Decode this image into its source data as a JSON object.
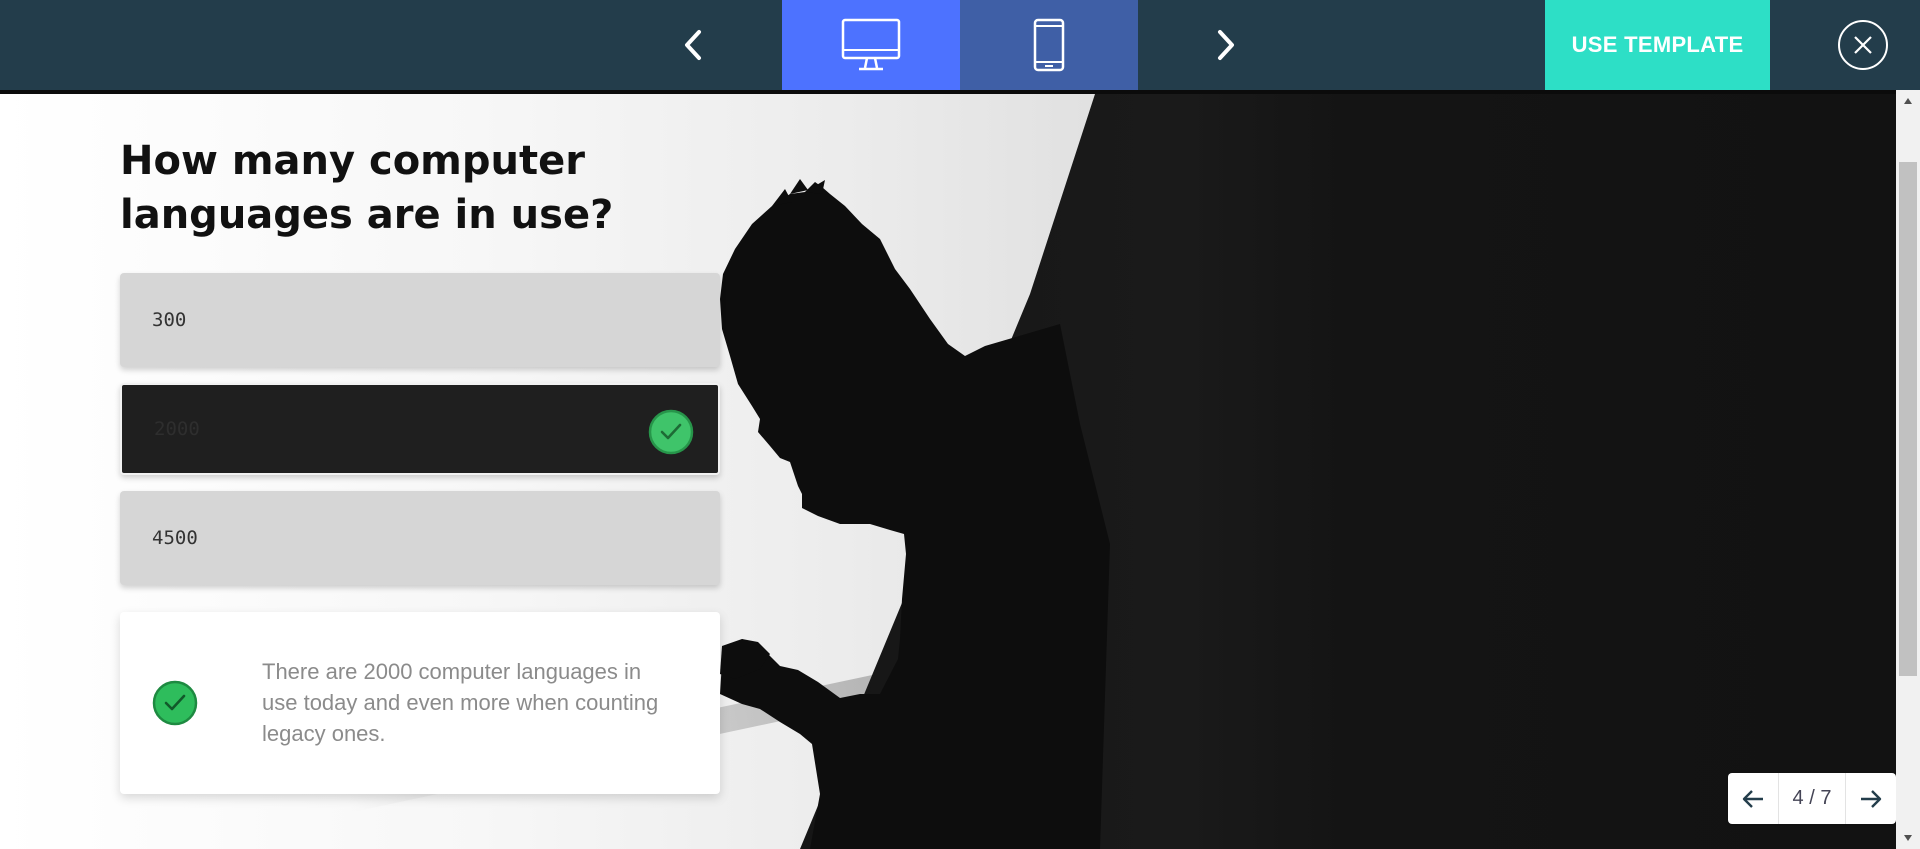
{
  "toolbar": {
    "prev_label": "previous",
    "next_label": "next",
    "use_template_label": "USE TEMPLATE",
    "colors": {
      "bar": "#233d4b",
      "desktop_active": "#4d72ff",
      "mobile": "#3f5fa6",
      "accent": "#2ddfc6"
    }
  },
  "quiz": {
    "question": "How many computer languages are in use?",
    "answers": [
      {
        "label": "300",
        "selected": false
      },
      {
        "label": "2000",
        "selected": true
      },
      {
        "label": "4500",
        "selected": false
      }
    ],
    "feedback": "There are 2000 computer languages in use today and even more when counting legacy ones.",
    "correct_color": "#2ebd5c"
  },
  "pager": {
    "current": 4,
    "total": 7,
    "label": "4 / 7"
  }
}
